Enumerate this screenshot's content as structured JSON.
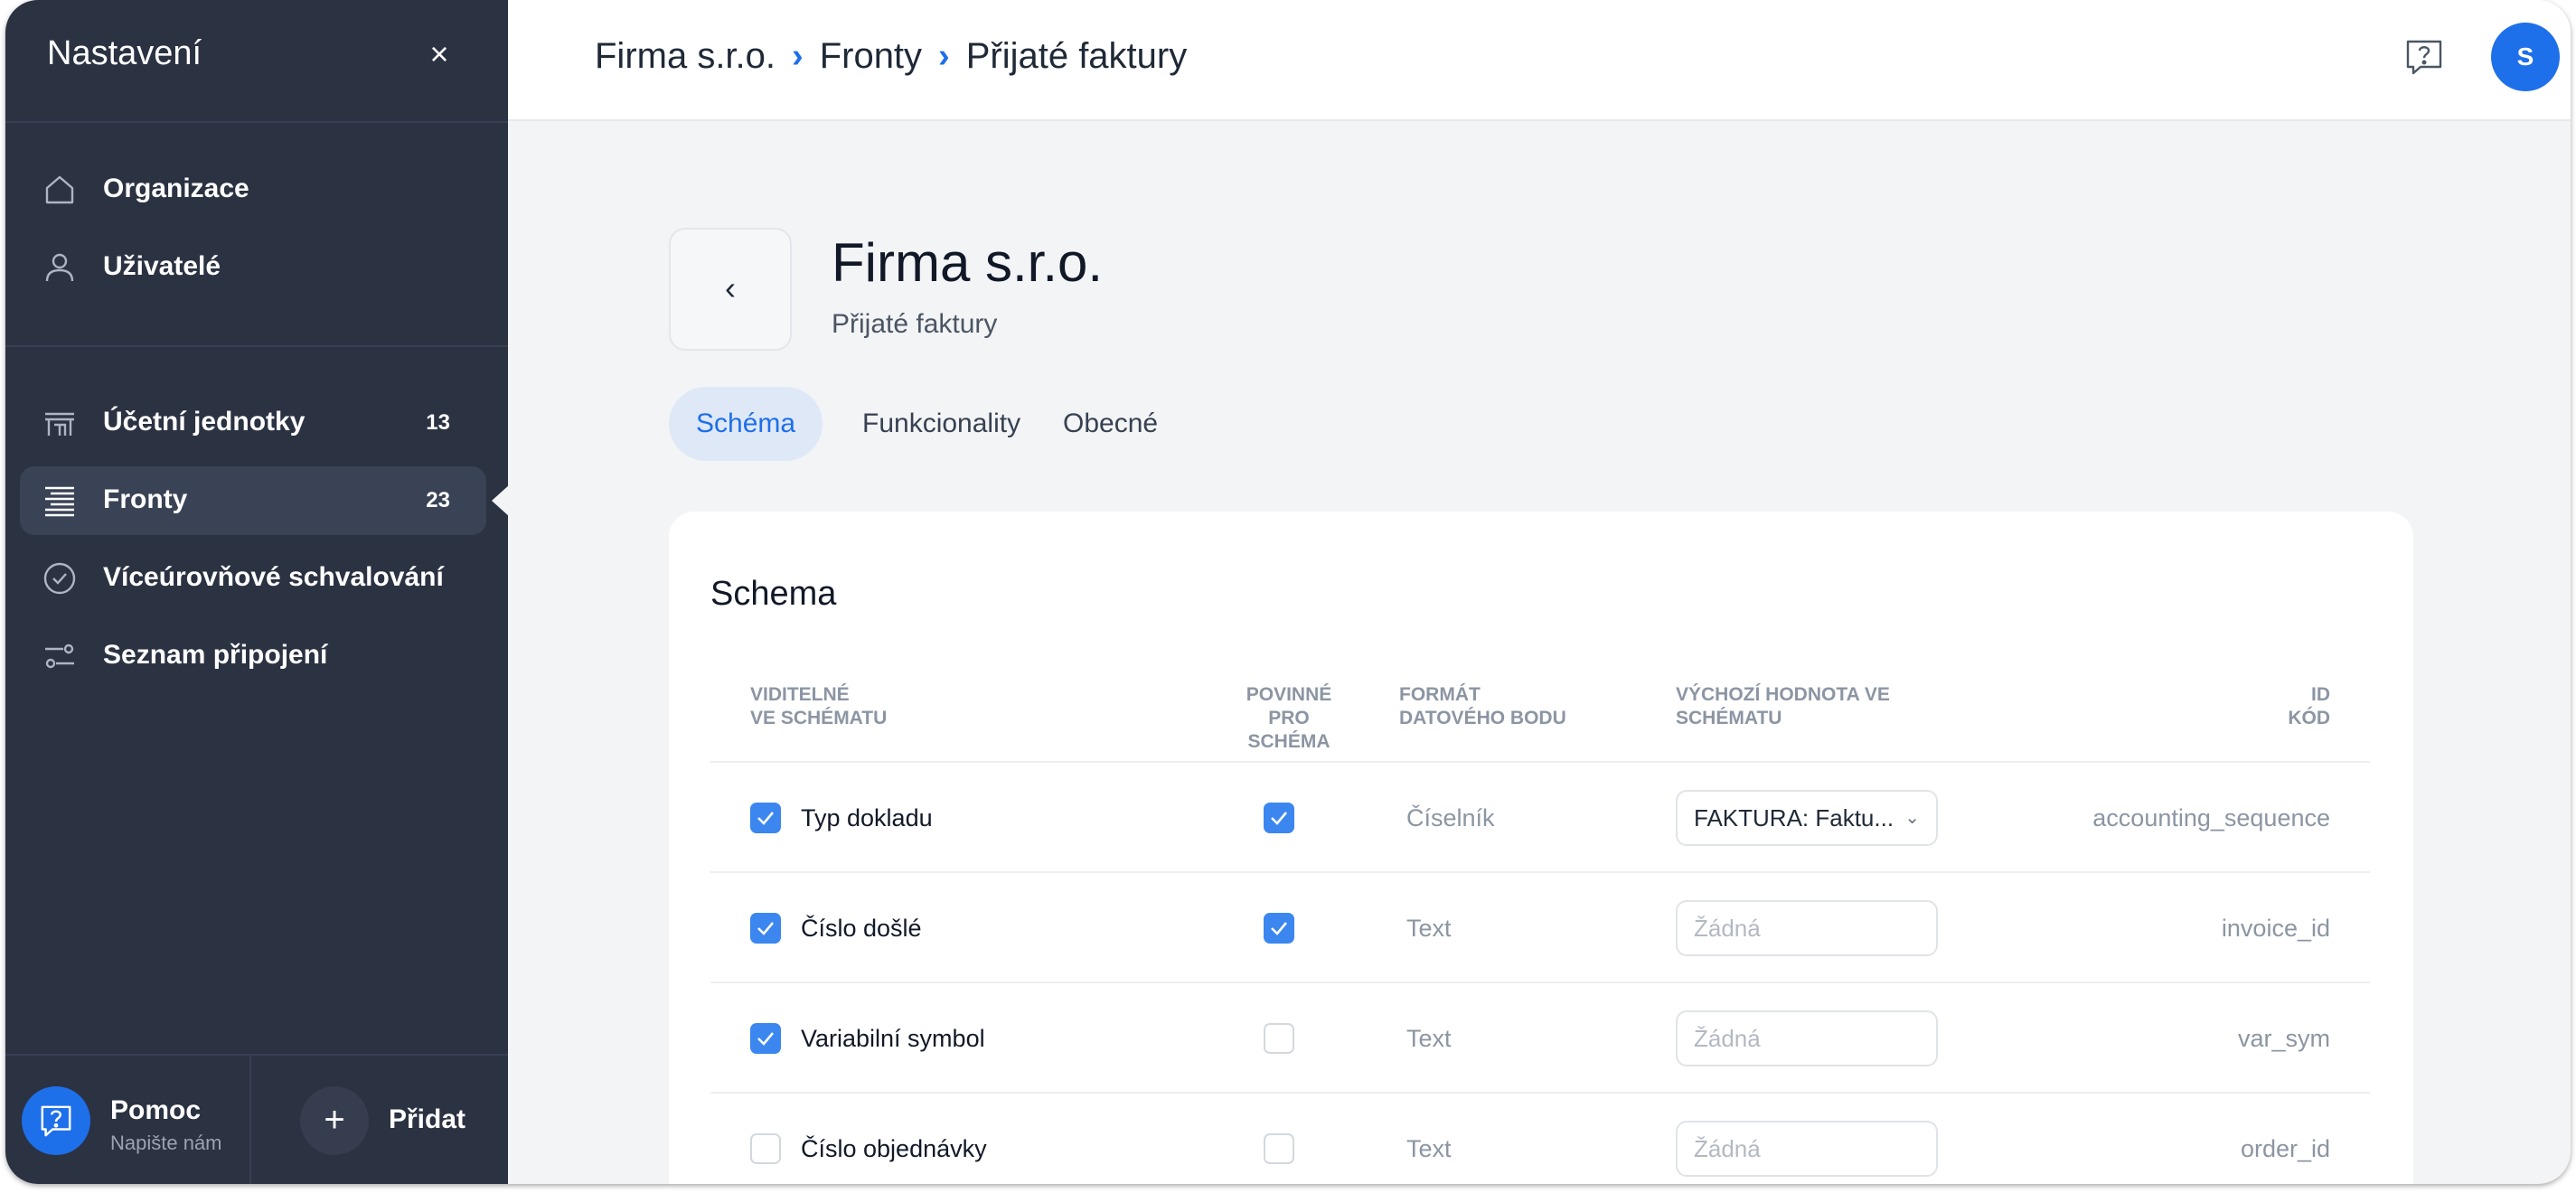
{
  "sidebar": {
    "title": "Nastavení",
    "close_icon": "close-icon",
    "items": [
      {
        "label": "Organizace",
        "icon": "home-icon",
        "count": ""
      },
      {
        "label": "Uživatelé",
        "icon": "user-icon",
        "count": ""
      },
      {
        "label": "Účetní jednotky",
        "icon": "building-icon",
        "count": "13"
      },
      {
        "label": "Fronty",
        "icon": "queue-icon",
        "count": "23",
        "active": true
      },
      {
        "label": "Víceúrovňové schvalování",
        "icon": "check-circle-icon",
        "count": ""
      },
      {
        "label": "Seznam připojení",
        "icon": "connections-icon",
        "count": ""
      }
    ],
    "footer": {
      "help_title": "Pomoc",
      "help_sub": "Napište nám",
      "add_label": "Přidat",
      "add_symbol": "+"
    }
  },
  "topbar": {
    "breadcrumb": [
      "Firma s.r.o.",
      "Fronty",
      "Přijaté faktury"
    ],
    "separator": "›",
    "avatar_initial": "S"
  },
  "page": {
    "back_symbol": "‹",
    "title": "Firma s.r.o.",
    "subtitle": "Přijaté faktury",
    "tabs": [
      "Schéma",
      "Funkcionality",
      "Obecné"
    ],
    "active_tab": "Schéma"
  },
  "schema": {
    "title": "Schema",
    "headers": {
      "visible": [
        "VIDITELNÉ",
        "VE SCHÉMATU"
      ],
      "required": [
        "POVINNÉ",
        "PRO SCHÉMA"
      ],
      "format": [
        "FORMÁT",
        "DATOVÉHO BODU"
      ],
      "default": [
        "VÝCHOZÍ HODNOTA VE",
        "SCHÉMATU"
      ],
      "id": [
        "ID",
        "KÓD"
      ]
    },
    "rows": [
      {
        "label": "Typ dokladu",
        "visible": true,
        "required": true,
        "format": "Číselník",
        "default": "FAKTURA: Faktu...",
        "is_select": true,
        "id": "accounting_sequence"
      },
      {
        "label": "Číslo došlé",
        "visible": true,
        "required": true,
        "format": "Text",
        "default": "Žádná",
        "is_select": false,
        "id": "invoice_id"
      },
      {
        "label": "Variabilní symbol",
        "visible": true,
        "required": false,
        "format": "Text",
        "default": "Žádná",
        "is_select": false,
        "id": "var_sym"
      },
      {
        "label": "Číslo objednávky",
        "visible": false,
        "required": false,
        "format": "Text",
        "default": "Žádná",
        "is_select": false,
        "id": "order_id"
      }
    ]
  },
  "colors": {
    "sidebar_bg": "#2b3242",
    "accent": "#1e6fea",
    "checkbox_on": "#3b86ef"
  }
}
